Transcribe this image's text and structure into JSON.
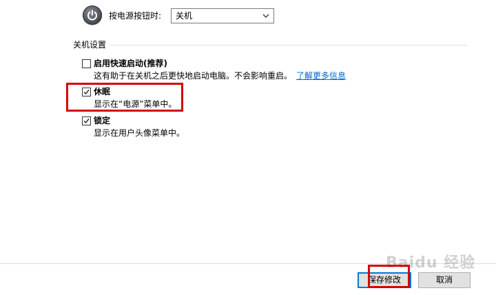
{
  "power": {
    "label": "按电源按钮时:",
    "selected": "关机"
  },
  "section": {
    "heading": "关机设置"
  },
  "options": [
    {
      "title": "启用快速启动(推荐)",
      "checked": false,
      "description": "这有助于在关机之后更快地启动电脑。不会影响重启。",
      "link": "了解更多信息"
    },
    {
      "title": "休眠",
      "checked": true,
      "description": "显示在“电源”菜单中。"
    },
    {
      "title": "锁定",
      "checked": true,
      "description": "显示在用户头像菜单中。"
    }
  ],
  "buttons": {
    "save": "保存修改",
    "cancel": "取消"
  },
  "watermark": "Baidu 经验",
  "colors": {
    "highlight": "#d40000",
    "link": "#0066cc",
    "default_button_border": "#0078d7"
  }
}
